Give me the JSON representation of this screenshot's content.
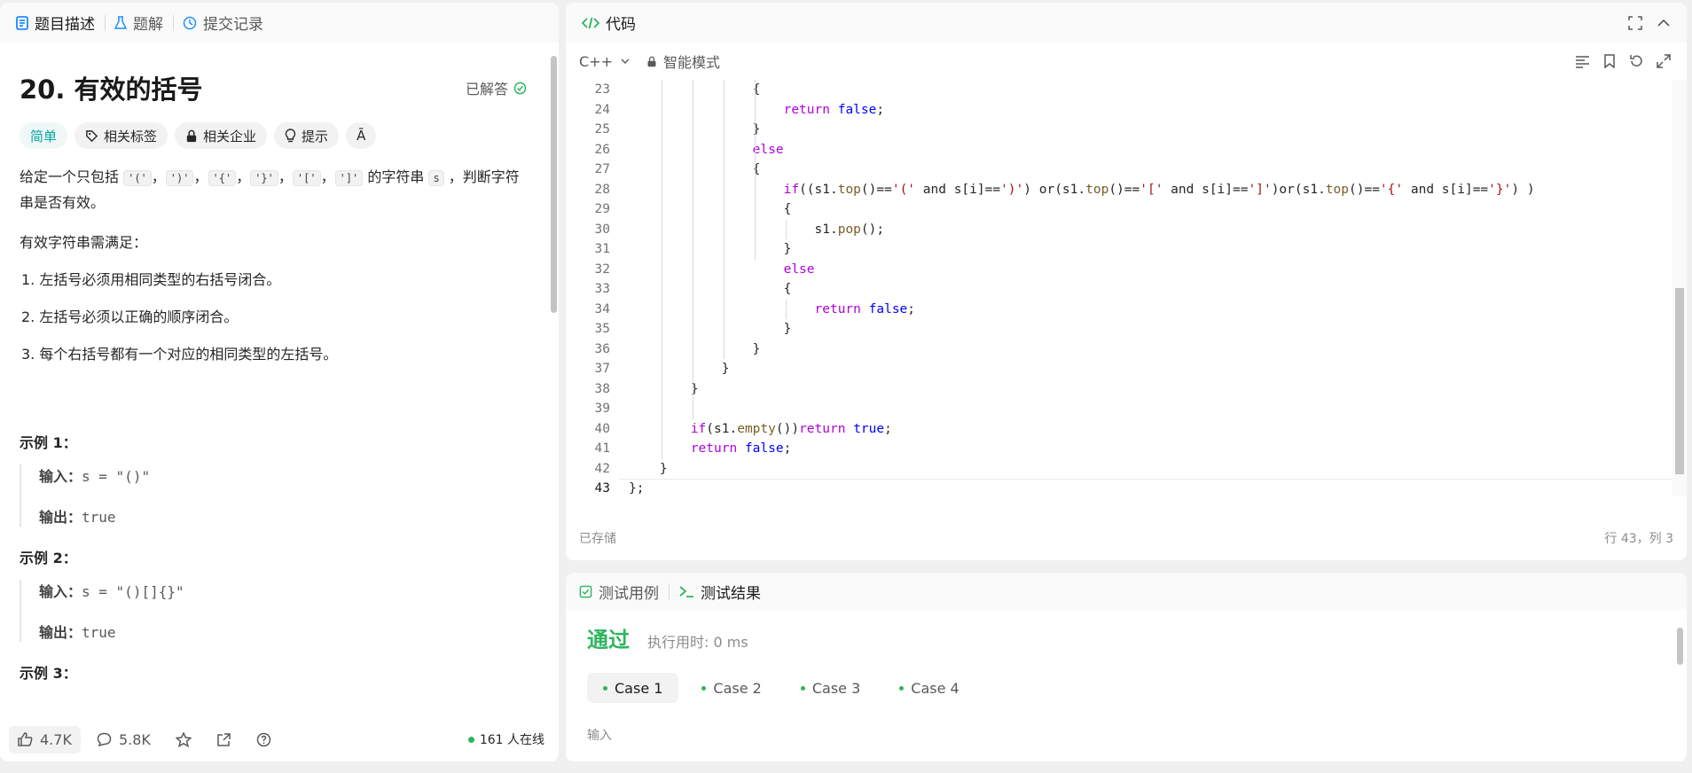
{
  "left_panel": {
    "tabs": [
      {
        "label": "题目描述",
        "icon": "document-icon"
      },
      {
        "label": "题解",
        "icon": "flask-icon"
      },
      {
        "label": "提交记录",
        "icon": "history-icon"
      }
    ],
    "title": "20. 有效的括号",
    "solved_label": "已解答",
    "tags": [
      {
        "label": "简单",
        "icon": ""
      },
      {
        "label": "相关标签",
        "icon": "tag-icon"
      },
      {
        "label": "相关企业",
        "icon": "lock-icon"
      },
      {
        "label": "提示",
        "icon": "bulb-icon"
      },
      {
        "label": "",
        "icon": "translate-icon"
      }
    ],
    "desc_pre": "给定一个只包括 ",
    "desc_codes": [
      "'('",
      "')'",
      "'{'",
      "'}'",
      "'['",
      "']'"
    ],
    "desc_sep": "，",
    "desc_mid": " 的字符串 ",
    "desc_var": "s",
    "desc_post": " ，判断字符串是否有效。",
    "requirement_intro": "有效字符串需满足：",
    "rules": [
      "1. 左括号必须用相同类型的右括号闭合。",
      "2. 左括号必须以正确的顺序闭合。",
      "3. 每个右括号都有一个对应的相同类型的左括号。"
    ],
    "examples": [
      {
        "title": "示例 1：",
        "input_label": "输入：",
        "input": "s = \"()\"",
        "output_label": "输出：",
        "output": "true"
      },
      {
        "title": "示例 2：",
        "input_label": "输入：",
        "input": "s = \"()[]{}\"",
        "output_label": "输出：",
        "output": "true"
      },
      {
        "title": "示例 3：",
        "input_label": "",
        "input": "",
        "output_label": "",
        "output": ""
      }
    ],
    "footer": {
      "likes": "4.7K",
      "comments": "5.8K",
      "online": "161 人在线"
    }
  },
  "editor": {
    "title": "代码",
    "language": "C++",
    "mode": "智能模式",
    "saved": "已存储",
    "cursor_pos": "行 43，列 3",
    "lines": [
      {
        "n": "23",
        "indent": 2,
        "code": [
          [
            "",
            "{"
          ]
        ]
      },
      {
        "n": "24",
        "indent": 3,
        "code": [
          [
            "kw",
            "return"
          ],
          [
            "",
            " "
          ],
          [
            "kb",
            "false"
          ],
          [
            "",
            ";"
          ]
        ]
      },
      {
        "n": "25",
        "indent": 2,
        "code": [
          [
            "",
            "}"
          ]
        ]
      },
      {
        "n": "26",
        "indent": 2,
        "code": [
          [
            "kw",
            "else"
          ]
        ]
      },
      {
        "n": "27",
        "indent": 2,
        "code": [
          [
            "",
            "{"
          ]
        ]
      },
      {
        "n": "28",
        "indent": 3,
        "code": [
          [
            "kw",
            "if"
          ],
          [
            "",
            "((s1."
          ],
          [
            "fn",
            "top"
          ],
          [
            "",
            "()=="
          ],
          [
            "st",
            "'('"
          ],
          [
            "",
            " and s[i]=="
          ],
          [
            "st",
            "')'"
          ],
          [
            "",
            ") or(s1."
          ],
          [
            "fn",
            "top"
          ],
          [
            "",
            "()=="
          ],
          [
            "st",
            "'['"
          ],
          [
            "",
            " and s[i]=="
          ],
          [
            "st",
            "']'"
          ],
          [
            "",
            ")or(s1."
          ],
          [
            "fn",
            "top"
          ],
          [
            "",
            "()=="
          ],
          [
            "st",
            "'{'"
          ],
          [
            "",
            " and s[i]=="
          ],
          [
            "st",
            "'}'"
          ],
          [
            "",
            ") )"
          ]
        ]
      },
      {
        "n": "29",
        "indent": 3,
        "code": [
          [
            "",
            "{"
          ]
        ]
      },
      {
        "n": "30",
        "indent": 4,
        "code": [
          [
            "",
            "s1."
          ],
          [
            "fn",
            "pop"
          ],
          [
            "",
            "();"
          ]
        ]
      },
      {
        "n": "31",
        "indent": 3,
        "code": [
          [
            "",
            "}"
          ]
        ]
      },
      {
        "n": "32",
        "indent": 3,
        "code": [
          [
            "kw",
            "else"
          ]
        ]
      },
      {
        "n": "33",
        "indent": 3,
        "code": [
          [
            "",
            "{"
          ]
        ]
      },
      {
        "n": "34",
        "indent": 4,
        "code": [
          [
            "kw",
            "return"
          ],
          [
            "",
            " "
          ],
          [
            "kb",
            "false"
          ],
          [
            "",
            ";"
          ]
        ]
      },
      {
        "n": "35",
        "indent": 3,
        "code": [
          [
            "",
            "}"
          ]
        ]
      },
      {
        "n": "36",
        "indent": 2,
        "code": [
          [
            "",
            "}"
          ]
        ]
      },
      {
        "n": "37",
        "indent": 1,
        "code": [
          [
            "",
            "}"
          ]
        ]
      },
      {
        "n": "38",
        "indent": 0,
        "code": [
          [
            "",
            "}"
          ]
        ]
      },
      {
        "n": "39",
        "indent": 0,
        "code": [
          [
            "",
            ""
          ]
        ]
      },
      {
        "n": "40",
        "indent": 0,
        "code": [
          [
            "kw",
            "if"
          ],
          [
            "",
            "(s1."
          ],
          [
            "fn",
            "empty"
          ],
          [
            "",
            "())"
          ],
          [
            "kw",
            "return"
          ],
          [
            "",
            " "
          ],
          [
            "kb",
            "true"
          ],
          [
            "",
            ";"
          ]
        ]
      },
      {
        "n": "41",
        "indent": 0,
        "code": [
          [
            "kw",
            "return"
          ],
          [
            "",
            " "
          ],
          [
            "kb",
            "false"
          ],
          [
            "",
            ";"
          ]
        ]
      },
      {
        "n": "42",
        "indent": -1,
        "code": [
          [
            "",
            "}"
          ]
        ]
      },
      {
        "n": "43",
        "indent": -2,
        "code": [
          [
            "",
            "};"
          ]
        ]
      }
    ]
  },
  "result": {
    "tabs": [
      "测试用例",
      "测试结果"
    ],
    "status": "通过",
    "runtime": "执行用时: 0 ms",
    "cases": [
      "Case 1",
      "Case 2",
      "Case 3",
      "Case 4"
    ],
    "input_label": "输入"
  },
  "colors": {
    "accent_green": "#2db55d",
    "easy_tag": "#00a5a6",
    "keyword": "#af00db",
    "literal": "#0000ff",
    "function": "#795e26",
    "string": "#a31515"
  }
}
